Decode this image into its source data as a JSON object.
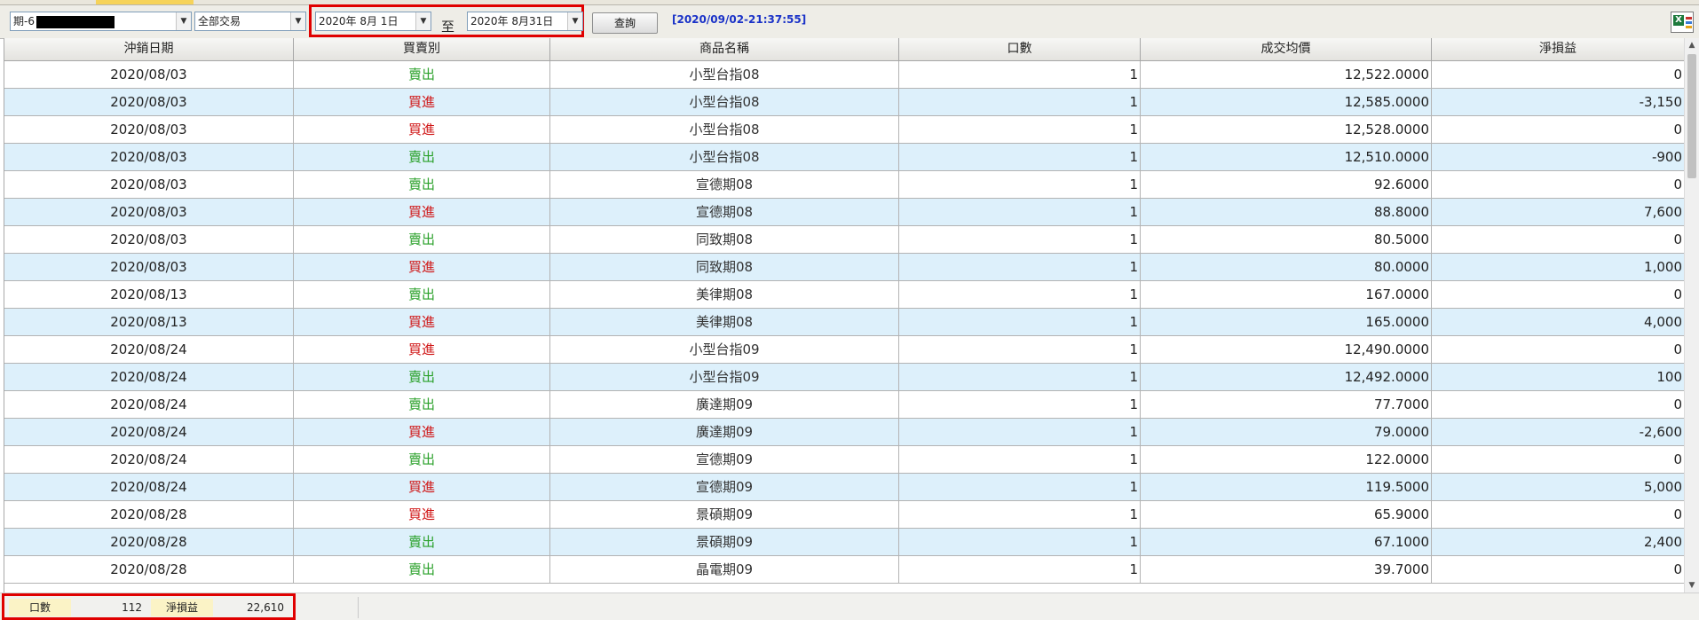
{
  "toolbar": {
    "account_prefix": "期-6",
    "trade_type": "全部交易",
    "start_date": "2020年  8月  1日",
    "end_date": "2020年  8月31日",
    "to_label": "至",
    "query_label": "查詢",
    "timestamp": "[2020/09/02-21:37:55]"
  },
  "columns": [
    "沖銷日期",
    "買賣別",
    "商品名稱",
    "口數",
    "成交均價",
    "淨損益"
  ],
  "rows": [
    {
      "date": "2020/08/03",
      "side": "賣出",
      "name": "小型台指08",
      "qty": "1",
      "price": "12,522.0000",
      "pnl": "0"
    },
    {
      "date": "2020/08/03",
      "side": "買進",
      "name": "小型台指08",
      "qty": "1",
      "price": "12,585.0000",
      "pnl": "-3,150"
    },
    {
      "date": "2020/08/03",
      "side": "買進",
      "name": "小型台指08",
      "qty": "1",
      "price": "12,528.0000",
      "pnl": "0"
    },
    {
      "date": "2020/08/03",
      "side": "賣出",
      "name": "小型台指08",
      "qty": "1",
      "price": "12,510.0000",
      "pnl": "-900"
    },
    {
      "date": "2020/08/03",
      "side": "賣出",
      "name": "宣德期08",
      "qty": "1",
      "price": "92.6000",
      "pnl": "0"
    },
    {
      "date": "2020/08/03",
      "side": "買進",
      "name": "宣德期08",
      "qty": "1",
      "price": "88.8000",
      "pnl": "7,600"
    },
    {
      "date": "2020/08/03",
      "side": "賣出",
      "name": "同致期08",
      "qty": "1",
      "price": "80.5000",
      "pnl": "0"
    },
    {
      "date": "2020/08/03",
      "side": "買進",
      "name": "同致期08",
      "qty": "1",
      "price": "80.0000",
      "pnl": "1,000"
    },
    {
      "date": "2020/08/13",
      "side": "賣出",
      "name": "美律期08",
      "qty": "1",
      "price": "167.0000",
      "pnl": "0"
    },
    {
      "date": "2020/08/13",
      "side": "買進",
      "name": "美律期08",
      "qty": "1",
      "price": "165.0000",
      "pnl": "4,000"
    },
    {
      "date": "2020/08/24",
      "side": "買進",
      "name": "小型台指09",
      "qty": "1",
      "price": "12,490.0000",
      "pnl": "0"
    },
    {
      "date": "2020/08/24",
      "side": "賣出",
      "name": "小型台指09",
      "qty": "1",
      "price": "12,492.0000",
      "pnl": "100"
    },
    {
      "date": "2020/08/24",
      "side": "賣出",
      "name": "廣達期09",
      "qty": "1",
      "price": "77.7000",
      "pnl": "0"
    },
    {
      "date": "2020/08/24",
      "side": "買進",
      "name": "廣達期09",
      "qty": "1",
      "price": "79.0000",
      "pnl": "-2,600"
    },
    {
      "date": "2020/08/24",
      "side": "賣出",
      "name": "宣德期09",
      "qty": "1",
      "price": "122.0000",
      "pnl": "0"
    },
    {
      "date": "2020/08/24",
      "side": "買進",
      "name": "宣德期09",
      "qty": "1",
      "price": "119.5000",
      "pnl": "5,000"
    },
    {
      "date": "2020/08/28",
      "side": "買進",
      "name": "景碩期09",
      "qty": "1",
      "price": "65.9000",
      "pnl": "0"
    },
    {
      "date": "2020/08/28",
      "side": "賣出",
      "name": "景碩期09",
      "qty": "1",
      "price": "67.1000",
      "pnl": "2,400"
    },
    {
      "date": "2020/08/28",
      "side": "賣出",
      "name": "晶電期09",
      "qty": "1",
      "price": "39.7000",
      "pnl": "0"
    }
  ],
  "summary": {
    "qty_label": "口數",
    "qty_value": "112",
    "pnl_label": "淨損益",
    "pnl_value": "22,610"
  },
  "colors": {
    "sell": "#2aa12a",
    "buy": "#d01818",
    "alt_row": "#ddf0fb",
    "highlight": "#e00000",
    "timestamp": "#1a32c8"
  },
  "icons": {
    "export": "excel-export-icon",
    "dropdown": "chevron-down-icon"
  }
}
